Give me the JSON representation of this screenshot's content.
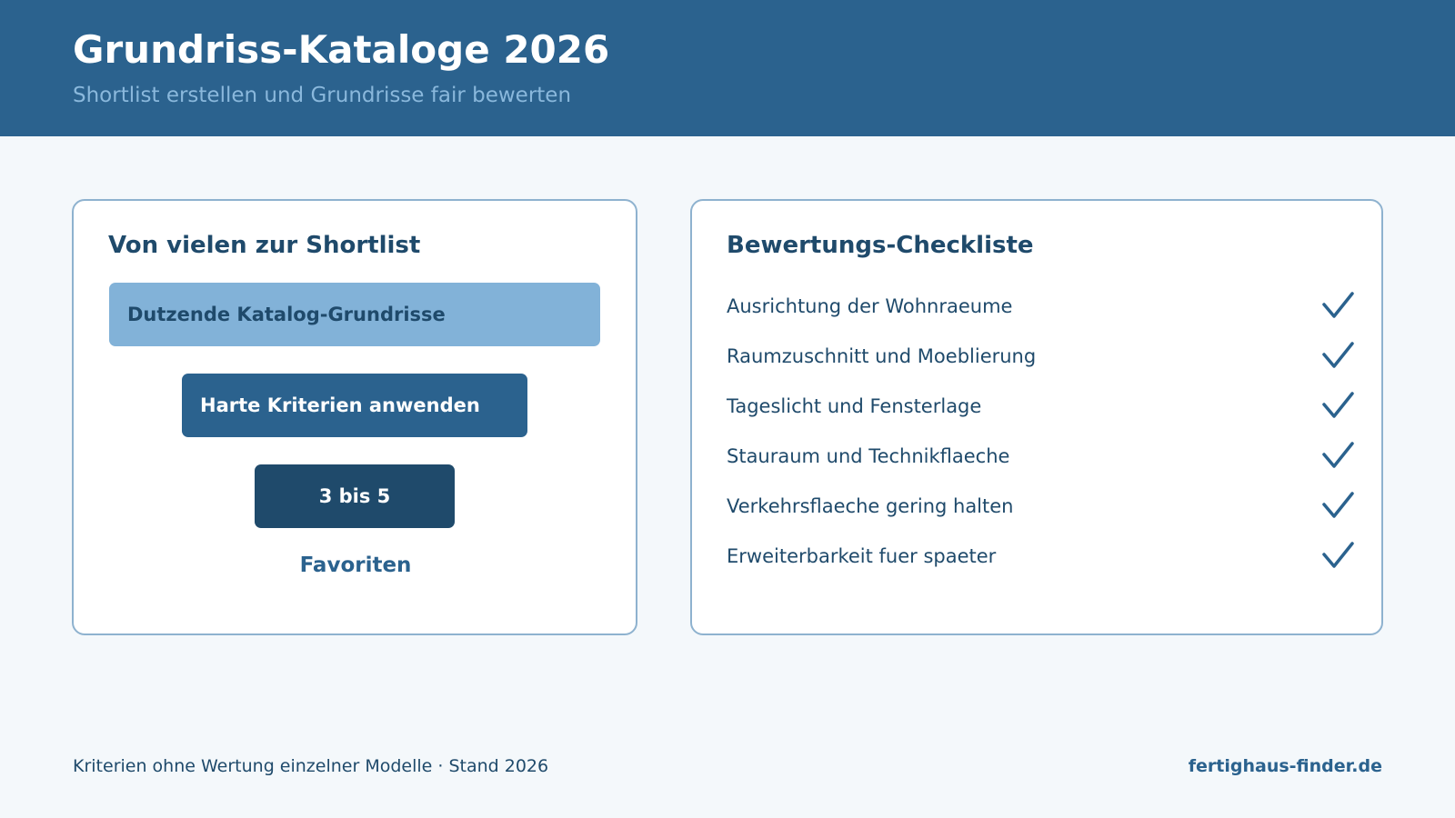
{
  "header": {
    "title": "Grundriss-Kataloge 2026",
    "subtitle": "Shortlist erstellen und Grundrisse fair bewerten"
  },
  "funnel": {
    "title": "Von vielen zur Shortlist",
    "steps": [
      "Dutzende Katalog-Grundrisse",
      "Harte Kriterien anwenden",
      "3 bis 5"
    ],
    "caption": "Favoriten"
  },
  "checklist": {
    "title": "Bewertungs-Checkliste",
    "icon": "check-icon",
    "items": [
      "Ausrichtung der Wohnraeume",
      "Raumzuschnitt und Moeblierung",
      "Tageslicht und Fensterlage",
      "Stauraum und Technikflaeche",
      "Verkehrsflaeche gering halten",
      "Erweiterbarkeit fuer spaeter"
    ]
  },
  "footer": {
    "note": "Kriterien ohne Wertung einzelner Modelle · Stand 2026",
    "brand": "fertighaus-finder.de"
  },
  "colors": {
    "header_bg": "#2b628e",
    "dark": "#1f4a6b",
    "light": "#82b2d8",
    "page_bg": "#f4f8fb"
  }
}
